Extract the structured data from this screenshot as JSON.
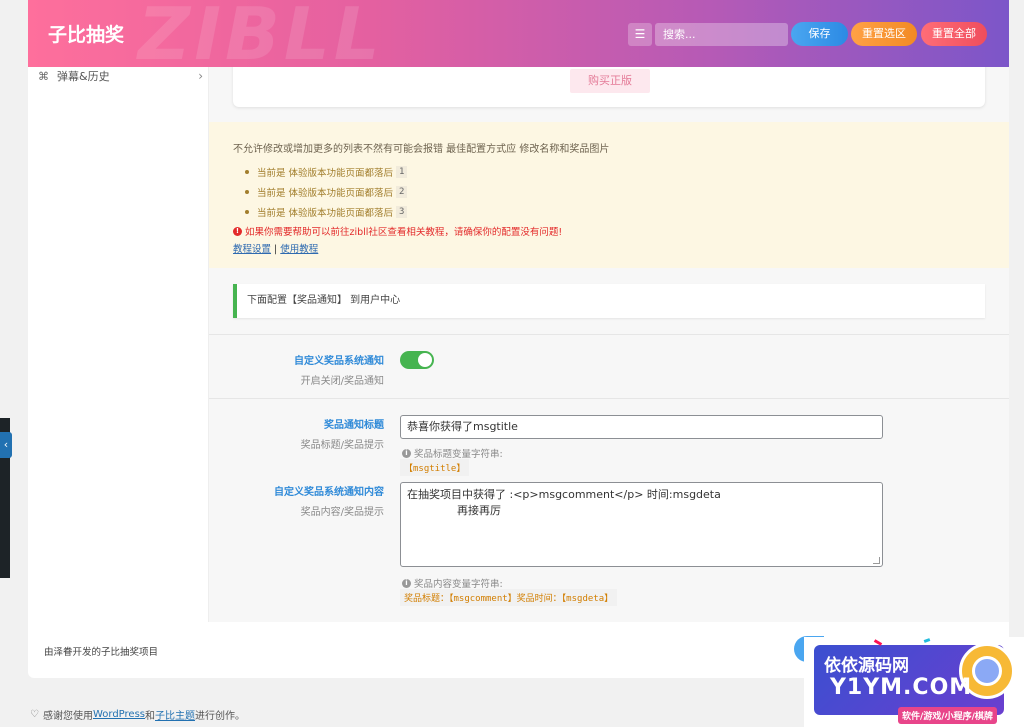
{
  "header": {
    "title": "子比抽奖",
    "watermark": "ZIBLL",
    "search_placeholder": "搜索...",
    "save_label": "保存",
    "reset_selection_label": "重置选区",
    "reset_all_label": "重置全部"
  },
  "sidebar": {
    "items": [
      {
        "label": "弹幕&历史"
      }
    ]
  },
  "top_card": {
    "buy_label": "购买正版"
  },
  "notice": {
    "intro": "不允许修改或增加更多的列表不然有可能会报错 最佳配置方式应 修改名称和奖品图片",
    "items": [
      {
        "text": "当前是 体验版本功能页面都落后",
        "code": "1"
      },
      {
        "text": "当前是 体验版本功能页面都落后",
        "code": "2"
      },
      {
        "text": "当前是 体验版本功能页面都落后",
        "code": "3"
      }
    ],
    "warning": "如果你需要帮助可以前往zibll社区查看相关教程，请确保你的配置没有问题!",
    "link1": "教程设置",
    "separator": "|",
    "link2": "使用教程"
  },
  "section": {
    "heading": "下面配置【奖品通知】 到用户中心"
  },
  "fields": {
    "switch": {
      "title": "自定义奖品系统通知",
      "subtitle": "开启关闭/奖品通知",
      "on": true
    },
    "notify_title": {
      "title": "奖品通知标题",
      "subtitle": "奖品标题/奖品提示",
      "value": "恭喜你获得了msgtitle",
      "help": "奖品标题变量字符串:",
      "tag": "【msgtitle】"
    },
    "notify_content": {
      "title": "自定义奖品系统通知内容",
      "subtitle": "奖品内容/奖品提示",
      "line1": "在抽奖项目中获得了 :<p>msgcomment</p> 时间:msgdeta",
      "line2": "再接再厉",
      "help": "奖品内容变量字符串:",
      "tag": "奖品标题：【msgcomment】奖品时间：【msgdeta】"
    }
  },
  "footer": {
    "text": "由泽眷开发的子比抽奖项目"
  },
  "credit": {
    "prefix": "感谢您使用",
    "link1": "WordPress",
    "mid": "和",
    "link2": "子比主题",
    "suffix": "进行创作。"
  },
  "ad": {
    "top": "依依源码网",
    "main": "Y1YM.COM",
    "sub": "软件/游戏/小程序/棋牌"
  },
  "colors": {
    "accent": "#2f8ad8",
    "toggle_on": "#46b450",
    "warning": "#e32b2b"
  }
}
